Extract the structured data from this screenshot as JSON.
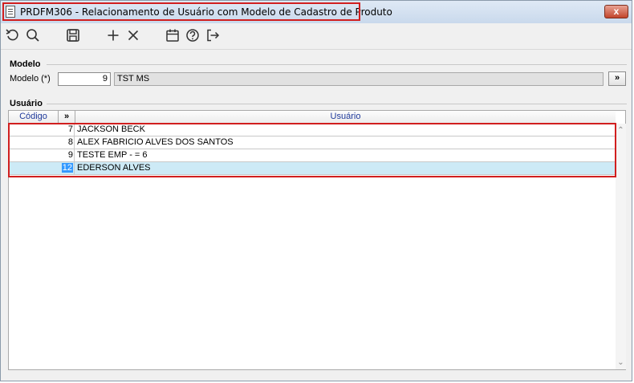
{
  "window": {
    "title": "PRDFM306 - Relacionamento de Usuário com Modelo de Cadastro de Produto",
    "close_label": "x"
  },
  "toolbar": {
    "buttons": [
      {
        "name": "refresh-icon"
      },
      {
        "name": "search-icon"
      },
      {
        "name": "save-icon"
      },
      {
        "name": "add-icon"
      },
      {
        "name": "delete-icon"
      },
      {
        "name": "calendar-icon"
      },
      {
        "name": "help-icon"
      },
      {
        "name": "exit-icon"
      }
    ]
  },
  "modelo": {
    "section_title": "Modelo",
    "field_label": "Modelo (*)",
    "code_value": "9",
    "name_value": "TST MS",
    "lookup_label": "»"
  },
  "usuario": {
    "section_title": "Usuário",
    "columns": {
      "code": "Código",
      "expand": "»",
      "user": "Usuário"
    },
    "rows": [
      {
        "code": "7",
        "name": "JACKSON BECK",
        "selected": false
      },
      {
        "code": "8",
        "name": "ALEX FABRICIO ALVES DOS SANTOS",
        "selected": false
      },
      {
        "code": "9",
        "name": "TESTE EMP - = 6",
        "selected": false
      },
      {
        "code": "12",
        "name": "EDERSON ALVES",
        "selected": true
      }
    ]
  },
  "colors": {
    "highlight": "#d11f1f",
    "selected_row": "#cdeaf6",
    "selected_code": "#3399ff",
    "header_text": "#1f3a9b"
  }
}
